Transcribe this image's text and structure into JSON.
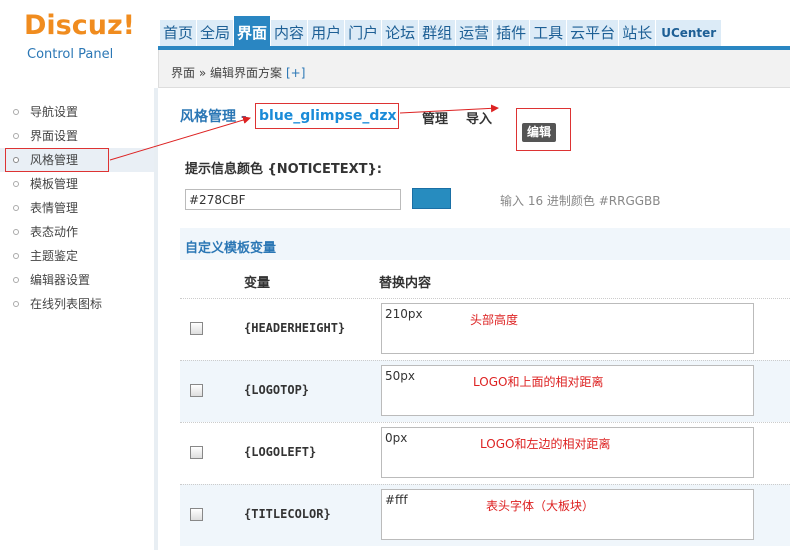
{
  "header": {
    "logo_main": "Discuz!",
    "logo_sub": "Control Panel",
    "nav": [
      {
        "label": "首页",
        "active": false
      },
      {
        "label": "全局",
        "active": false
      },
      {
        "label": "界面",
        "active": true
      },
      {
        "label": "内容",
        "active": false
      },
      {
        "label": "用户",
        "active": false
      },
      {
        "label": "门户",
        "active": false
      },
      {
        "label": "论坛",
        "active": false
      },
      {
        "label": "群组",
        "active": false
      },
      {
        "label": "运营",
        "active": false
      },
      {
        "label": "插件",
        "active": false
      },
      {
        "label": "工具",
        "active": false
      },
      {
        "label": "云平台",
        "active": false
      },
      {
        "label": "站长",
        "active": false
      },
      {
        "label": "UCenter",
        "active": false
      }
    ]
  },
  "breadcrumb": {
    "text": "界面 » 编辑界面方案",
    "add": "[+]"
  },
  "sidebar": {
    "items": [
      {
        "label": "导航设置",
        "active": false
      },
      {
        "label": "界面设置",
        "active": false
      },
      {
        "label": "风格管理",
        "active": true
      },
      {
        "label": "模板管理",
        "active": false
      },
      {
        "label": "表情管理",
        "active": false
      },
      {
        "label": "表态动作",
        "active": false
      },
      {
        "label": "主题鉴定",
        "active": false
      },
      {
        "label": "编辑器设置",
        "active": false
      },
      {
        "label": "在线列表图标",
        "active": false
      }
    ]
  },
  "tabs": {
    "style_manage": "风格管理 -",
    "style_name": "blue_glimpse_dzx",
    "manage": "管理",
    "import": "导入",
    "edit": "编辑"
  },
  "notice": {
    "label": "提示信息颜色 {NOTICETEXT}:",
    "value": "#278CBF",
    "swatch_color": "#278CBF",
    "hint": "输入 16 进制颜色 #RRGGBB"
  },
  "custom": {
    "title": "自定义模板变量",
    "col_var": "变量",
    "col_replace": "替换内容",
    "rows": [
      {
        "name": "{HEADERHEIGHT}",
        "value": "210px",
        "note": "头部高度"
      },
      {
        "name": "{LOGOTOP}",
        "value": "50px",
        "note": "LOGO和上面的相对距离"
      },
      {
        "name": "{LOGOLEFT}",
        "value": "0px",
        "note": "LOGO和左边的相对距离"
      },
      {
        "name": "{TITLECOLOR}",
        "value": "#fff",
        "note": "表头字体（大板块）"
      }
    ]
  },
  "colors": {
    "accent": "#2A86C2",
    "logo_orange": "#F08C1F",
    "annotation_red": "#DD2222"
  }
}
